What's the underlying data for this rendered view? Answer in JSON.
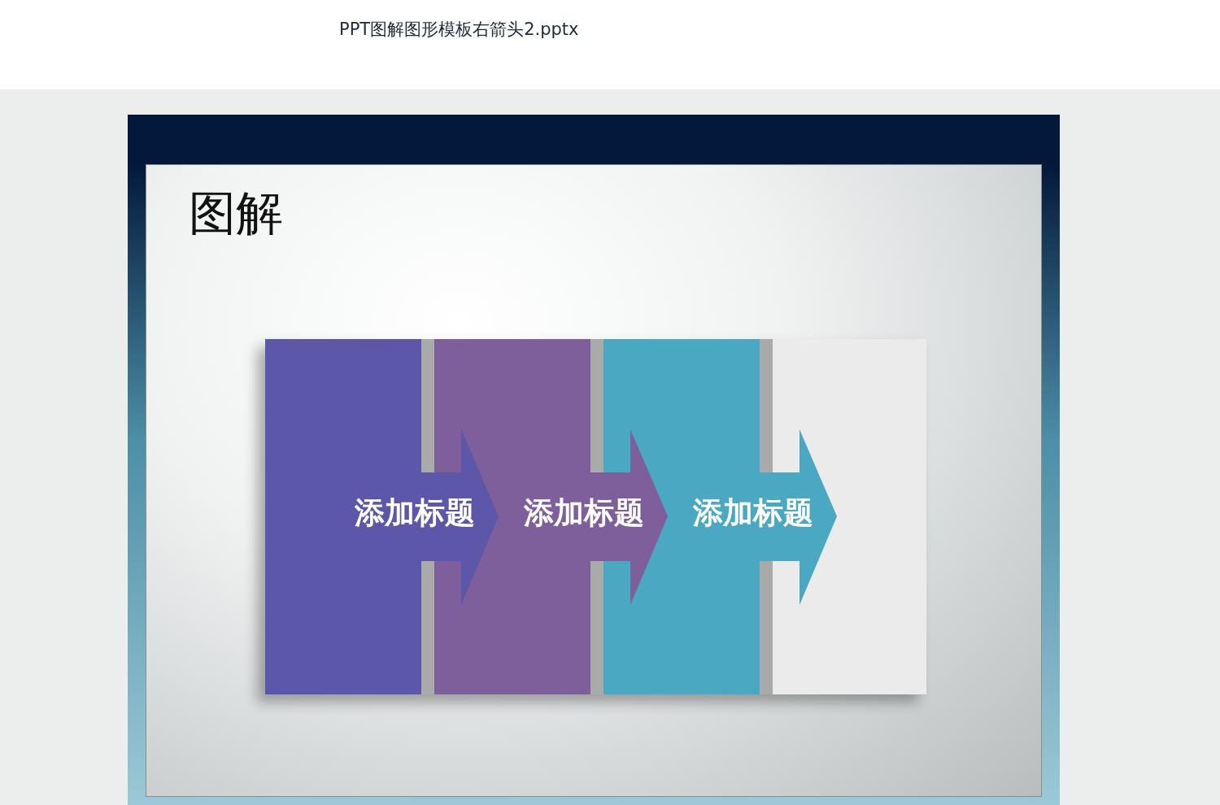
{
  "header": {
    "filename": "PPT图解图形模板右箭头2.pptx"
  },
  "slide": {
    "title": "图解",
    "steps": [
      {
        "label": "添加标题",
        "color": "#5c57a8"
      },
      {
        "label": "添加标题",
        "color": "#7e5f9b"
      },
      {
        "label": "添加标题",
        "color": "#4aa8c2"
      },
      {
        "color": "#eaebea"
      }
    ]
  }
}
